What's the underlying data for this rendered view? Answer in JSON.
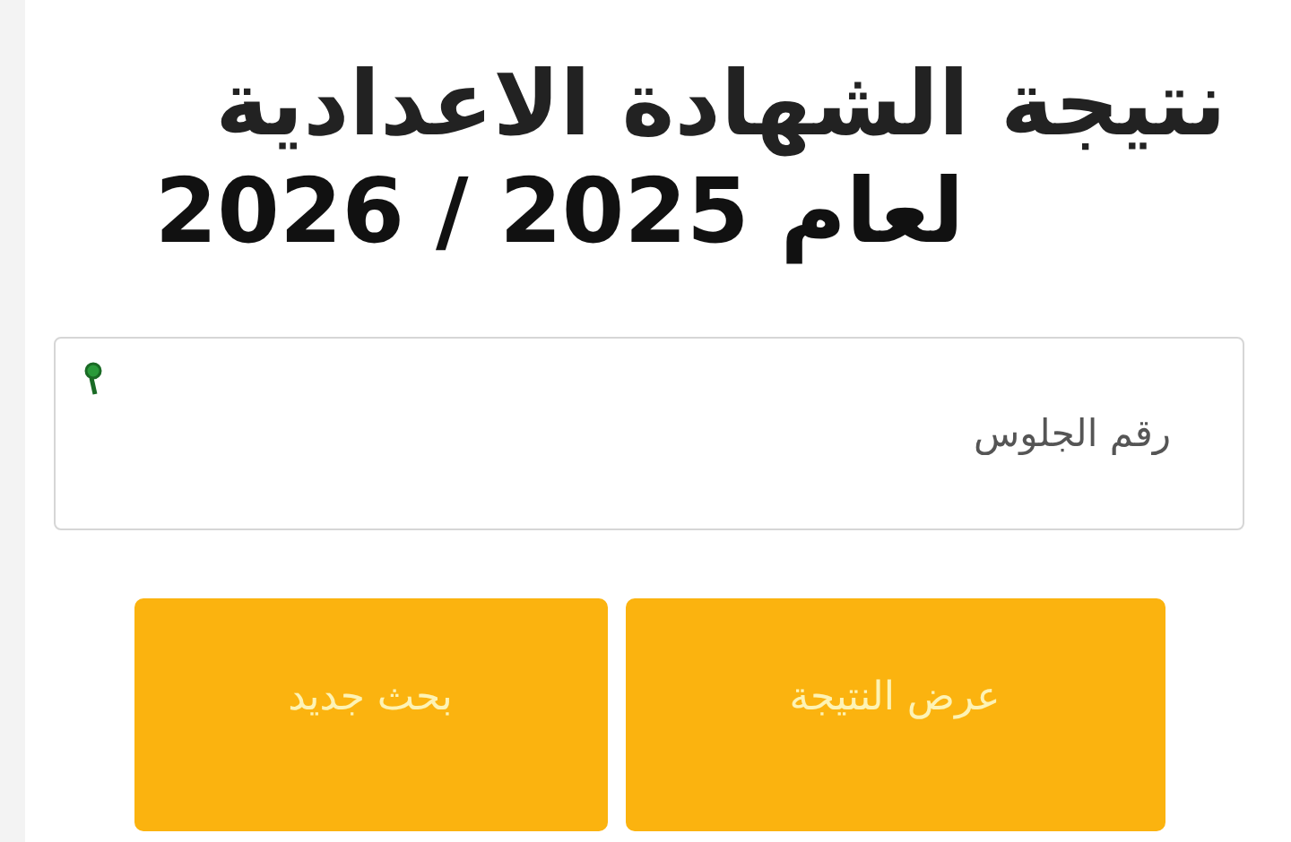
{
  "title": {
    "line_1": "نتيجة الشهادة الاعدادية",
    "line_2": "لعام 2025 / 2026"
  },
  "search": {
    "placeholder": "رقم الجلوس"
  },
  "buttons": [
    {
      "label": "عرض النتيجة"
    },
    {
      "label": "بحث جديد"
    }
  ]
}
